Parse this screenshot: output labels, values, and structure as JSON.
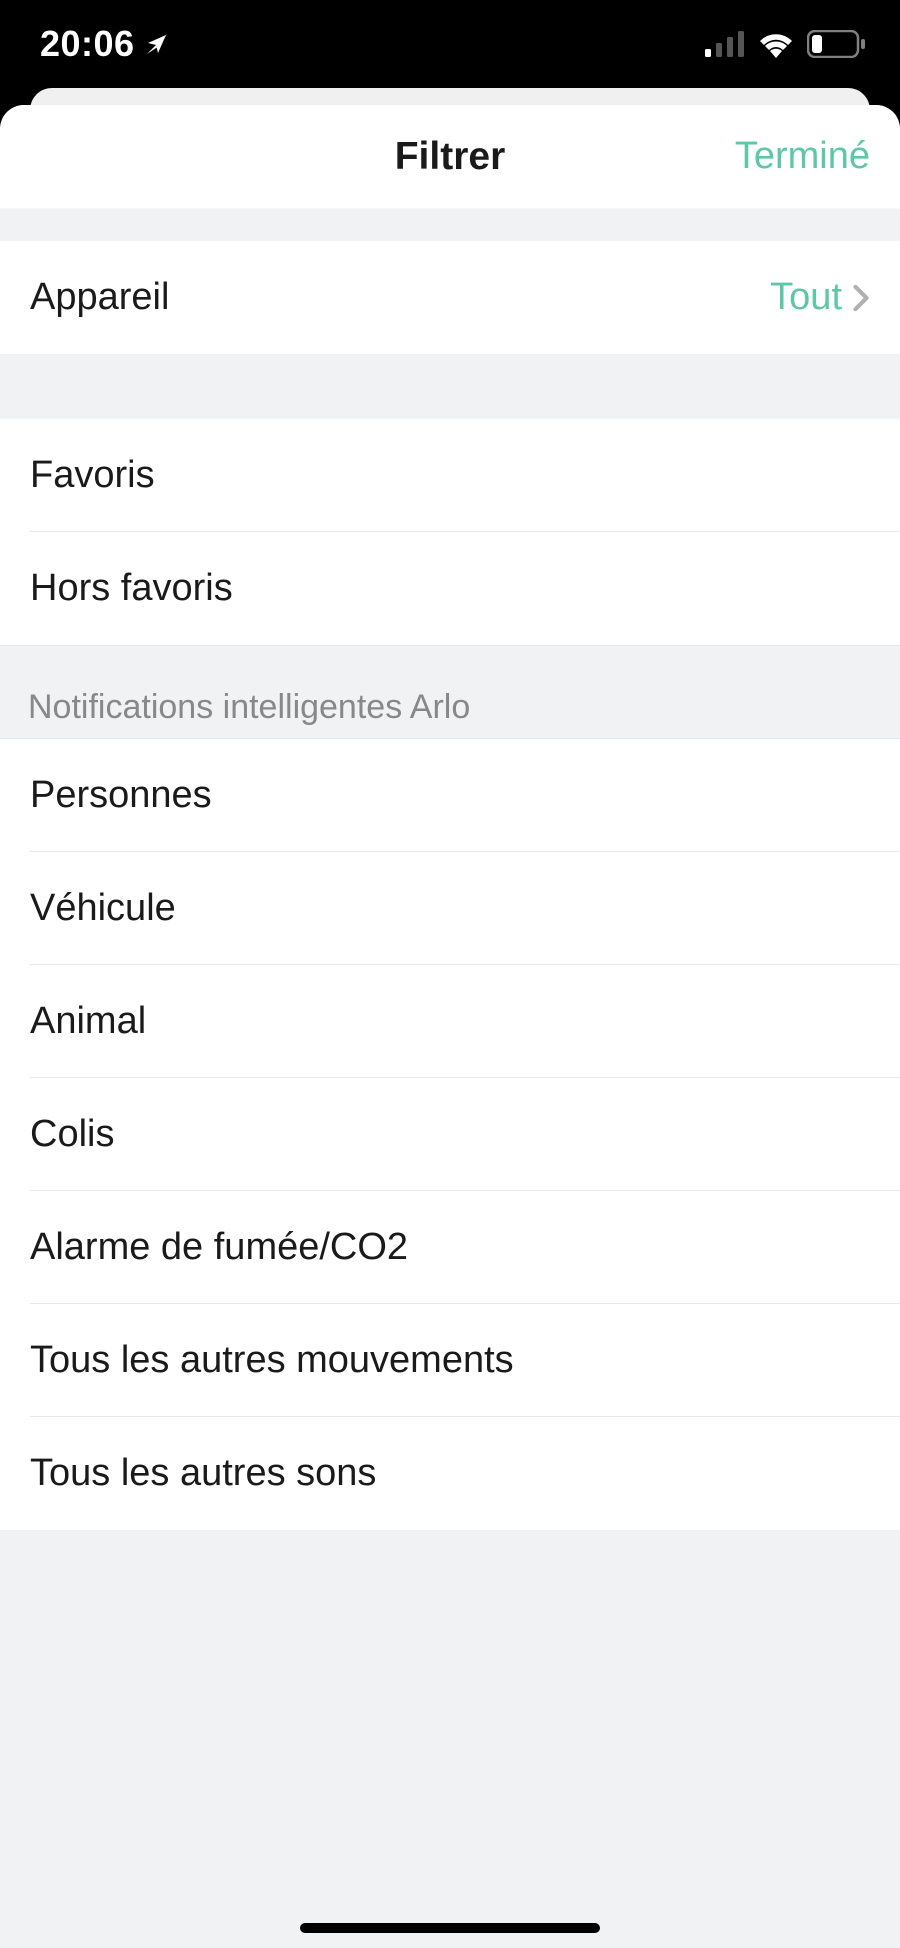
{
  "status_bar": {
    "time": "20:06"
  },
  "modal": {
    "title": "Filtrer",
    "done": "Terminé"
  },
  "device_row": {
    "label": "Appareil",
    "value": "Tout"
  },
  "favorites_section": {
    "favorites": "Favoris",
    "non_favorites": "Hors favoris"
  },
  "smart_section": {
    "header": "Notifications intelligentes Arlo",
    "items": [
      "Personnes",
      "Véhicule",
      "Animal",
      "Colis",
      "Alarme de fumée/CO2",
      "Tous les autres mouvements",
      "Tous les autres sons"
    ]
  }
}
